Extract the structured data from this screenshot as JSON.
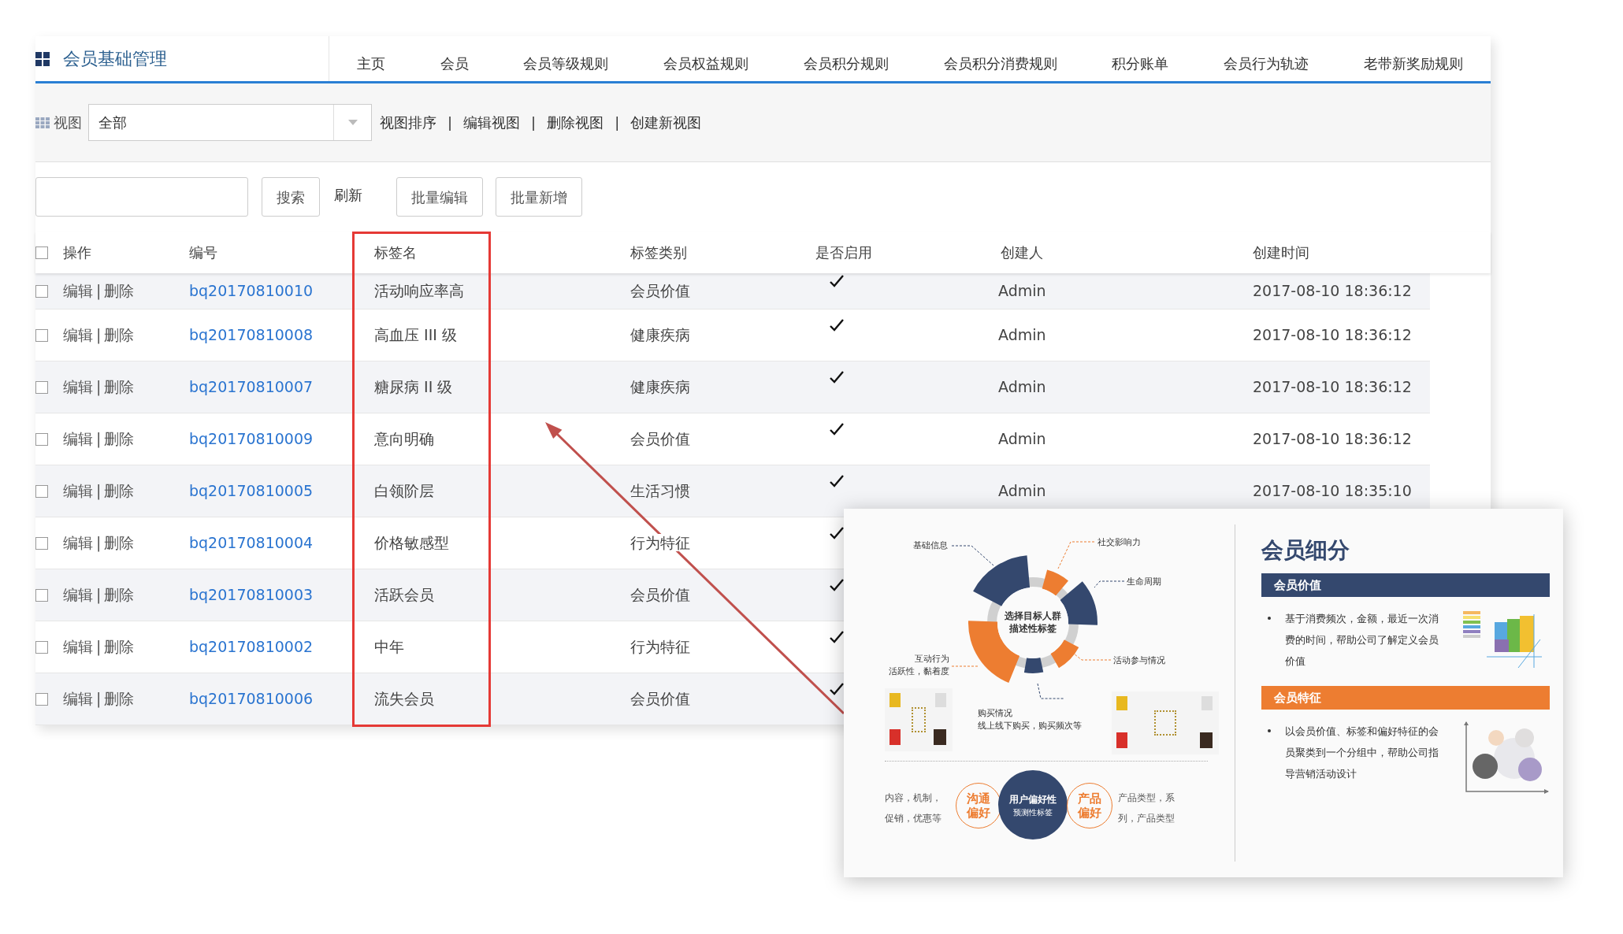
{
  "app": {
    "title": "会员基础管理",
    "nav": [
      "主页",
      "会员",
      "会员等级规则",
      "会员权益规则",
      "会员积分规则",
      "会员积分消费规则",
      "积分账单",
      "会员行为轨迹",
      "老带新奖励规则"
    ]
  },
  "view_bar": {
    "label": "视图",
    "select": {
      "value": "全部"
    },
    "links": [
      {
        "label": "视图排序",
        "separator": "|"
      },
      {
        "label": "编辑视图",
        "separator": "|"
      },
      {
        "label": "删除视图",
        "separator": "|"
      },
      {
        "label": "创建新视图"
      }
    ]
  },
  "toolbar": {
    "actions": [
      {
        "kind": "button",
        "label": "搜索"
      },
      {
        "kind": "link",
        "label": "刷新"
      },
      {
        "kind": "button",
        "label": "批量编辑"
      },
      {
        "kind": "button",
        "label": "批量新增"
      }
    ]
  },
  "table": {
    "select_all": {
      "checked": false
    },
    "columns": [
      {
        "label": "操作",
        "highlighted": false
      },
      {
        "label": "编号",
        "highlighted": false
      },
      {
        "label": "标签名",
        "highlighted": true
      },
      {
        "label": "标签类别",
        "highlighted": false
      },
      {
        "label": "是否启用",
        "highlighted": false
      },
      {
        "label": "创建人",
        "highlighted": false
      },
      {
        "label": "创建时间",
        "highlighted": false
      }
    ],
    "rows": [
      {
        "checked": false,
        "edit": "编辑",
        "separator": "|",
        "delete": "删除",
        "id": "bq20170810010",
        "name": "活动响应率高",
        "category": "会员价值",
        "enabled": true,
        "creator": "Admin",
        "created": "2017-08-10 18:36:12"
      },
      {
        "checked": false,
        "edit": "编辑",
        "separator": "|",
        "delete": "删除",
        "id": "bq20170810008",
        "name": "高血压 III 级",
        "category": "健康疾病",
        "enabled": true,
        "creator": "Admin",
        "created": "2017-08-10 18:36:12"
      },
      {
        "checked": false,
        "edit": "编辑",
        "separator": "|",
        "delete": "删除",
        "id": "bq20170810007",
        "name": "糖尿病 II 级",
        "category": "健康疾病",
        "enabled": true,
        "creator": "Admin",
        "created": "2017-08-10 18:36:12"
      },
      {
        "checked": false,
        "edit": "编辑",
        "separator": "|",
        "delete": "删除",
        "id": "bq20170810009",
        "name": "意向明确",
        "category": "会员价值",
        "enabled": true,
        "creator": "Admin",
        "created": "2017-08-10 18:36:12"
      },
      {
        "checked": false,
        "edit": "编辑",
        "separator": "|",
        "delete": "删除",
        "id": "bq20170810005",
        "name": "白领阶层",
        "category": "生活习惯",
        "enabled": true,
        "creator": "Admin",
        "created": "2017-08-10 18:35:10"
      },
      {
        "checked": false,
        "edit": "编辑",
        "separator": "|",
        "delete": "删除",
        "id": "bq20170810004",
        "name": "价格敏感型",
        "category": "行为特征",
        "enabled": true
      },
      {
        "checked": false,
        "edit": "编辑",
        "separator": "|",
        "delete": "删除",
        "id": "bq20170810003",
        "name": "活跃会员",
        "category": "会员价值",
        "enabled": true
      },
      {
        "checked": false,
        "edit": "编辑",
        "separator": "|",
        "delete": "删除",
        "id": "bq20170810002",
        "name": "中年",
        "category": "行为特征",
        "enabled": true
      },
      {
        "checked": false,
        "edit": "编辑",
        "separator": "|",
        "delete": "删除",
        "id": "bq20170810006",
        "name": "流失会员",
        "category": "会员价值",
        "enabled": true
      }
    ]
  },
  "promo_card": {
    "diagram": {
      "center": [
        "选择目标人群",
        "描述性标签"
      ],
      "basic_info": "基础信息",
      "social": "社交影响力",
      "lifecycle": "生命周期",
      "activity": "活动参与情况",
      "interaction": [
        "互动行为",
        "活跃性，黏着度"
      ],
      "purchase": [
        "购买情况",
        "线上线下购买，购买频次等"
      ]
    },
    "preferences": {
      "left_text": [
        "内容，机制，",
        "促销，优惠等"
      ],
      "left_badge": [
        "沟通",
        "偏好"
      ],
      "center": [
        "用户偏好性",
        "预测性标签"
      ],
      "right_badge": [
        "产品",
        "偏好"
      ],
      "right_text": [
        "产品类型，系",
        "列，产品类型"
      ]
    },
    "segmentation": {
      "title": "会员细分",
      "sections": [
        {
          "heading": "会员价值",
          "color": "#34486e",
          "bullet": "基于消费频次，金额，最近一次消费的时间，帮助公司了解定义会员价值",
          "kind": "cube"
        },
        {
          "heading": "会员特征",
          "color": "#ed7d31",
          "bullet": "以会员价值、标签和偏好特征的会员聚类到一个分组中，帮助公司指导营销活动设计",
          "kind": "cluster"
        }
      ]
    }
  }
}
